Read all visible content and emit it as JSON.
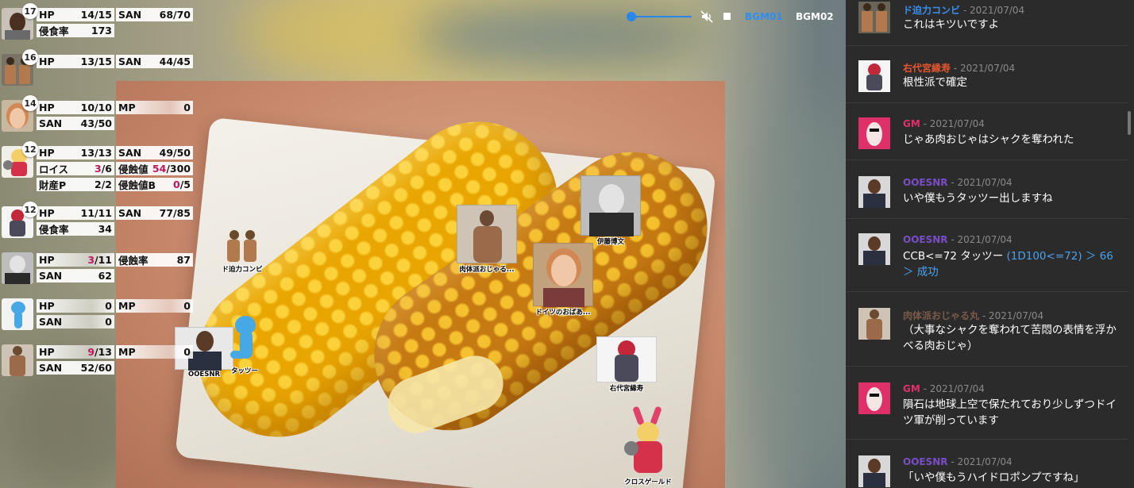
{
  "characters": [
    {
      "level": "17",
      "stats": [
        {
          "k": "HP",
          "v": "14/15",
          "k2": "SAN",
          "v2": "68/70"
        },
        {
          "k": "侵食率",
          "v": "173"
        }
      ]
    },
    {
      "level": "16",
      "stats": [
        {
          "k": "HP",
          "v": "13/15",
          "k2": "SAN",
          "v2": "44/45"
        }
      ]
    },
    {
      "level": "14",
      "stats": [
        {
          "k": "HP",
          "v": "10/10",
          "k2": "MP",
          "v2": "0"
        },
        {
          "k": "SAN",
          "v": "43/50"
        }
      ]
    },
    {
      "level": "12",
      "stats": [
        {
          "k": "HP",
          "v": "13/13",
          "k2": "SAN",
          "v2": "49/50"
        },
        {
          "k": "ロイス",
          "v_red": "3",
          "v_rest": "/6",
          "k2": "侵蝕値",
          "v2_red": "54",
          "v2_rest": "/300"
        },
        {
          "k": "財産P",
          "v": "2/2",
          "k2": "侵蝕値B",
          "v2_red": "0",
          "v2_rest": "/5"
        }
      ]
    },
    {
      "level": "12",
      "stats": [
        {
          "k": "HP",
          "v": "11/11",
          "k2": "SAN",
          "v2": "77/85"
        },
        {
          "k": "侵食率",
          "v": "34"
        }
      ]
    },
    {
      "level": "",
      "stats": [
        {
          "k": "HP",
          "v_red": "3",
          "v_rest": "/11",
          "k2": "侵蝕率",
          "v2": "87"
        },
        {
          "k": "SAN",
          "v": "62"
        }
      ]
    },
    {
      "level": "",
      "stats": [
        {
          "k": "HP",
          "v": "0",
          "k2": "MP",
          "v2": "0"
        },
        {
          "k": "SAN",
          "v": "0"
        }
      ]
    },
    {
      "level": "",
      "stats": [
        {
          "k": "HP",
          "v_red": "9",
          "v_rest": "/13",
          "k2": "MP",
          "v2": "0"
        },
        {
          "k": "SAN",
          "v": "52/60"
        }
      ]
    }
  ],
  "tokens": {
    "t1": "ド迫力コンビ",
    "t2": "肉体派おじゃる...",
    "t3": "伊藤博文",
    "t4": "ドイツのおばあ...",
    "t5": "OOESNR",
    "t6": "タッツー",
    "t7": "右代宮縁寿",
    "t8": "クロスゲールド"
  },
  "audio": {
    "bgm1": "BGM01",
    "bgm2": "BGM02",
    "volume": 0.08,
    "muted": true
  },
  "chat": [
    {
      "name": "ド迫力コンビ",
      "color": "#3a8ff0",
      "date": " - 2021/07/04",
      "body": "これはキツいですよ"
    },
    {
      "name": "右代宮縁寿",
      "color": "#e5562f",
      "date": " - 2021/07/04",
      "body": "根性派で確定"
    },
    {
      "name": "GM",
      "color": "#e0306a",
      "date": " - 2021/07/04",
      "body": "じゃあ肉おじゃはシャクを奪われた"
    },
    {
      "name": "OOESNR",
      "color": "#7a4ec9",
      "date": " - 2021/07/04",
      "body": "いや僕もうタッツー出しますね"
    },
    {
      "name": "OOESNR",
      "color": "#7a4ec9",
      "date": " - 2021/07/04",
      "body_pre": "CCB<=72 タッツー ",
      "body_dice": "(1D100<=72) ＞ 66 ＞ 成功"
    },
    {
      "name": "肉体派おじゃる丸",
      "color": "#7a5a4a",
      "date": " - 2021/07/04",
      "body": "（大事なシャクを奪われて苦悶の表情を浮かべる肉おじゃ）"
    },
    {
      "name": "GM",
      "color": "#e0306a",
      "date": " - 2021/07/04",
      "body": "隕石は地球上空で保たれており少しずつドイツ軍が削っています"
    },
    {
      "name": "OOESNR",
      "color": "#7a4ec9",
      "date": " - 2021/07/04",
      "body": "「いや僕もうハイドロポンプですね」"
    }
  ]
}
